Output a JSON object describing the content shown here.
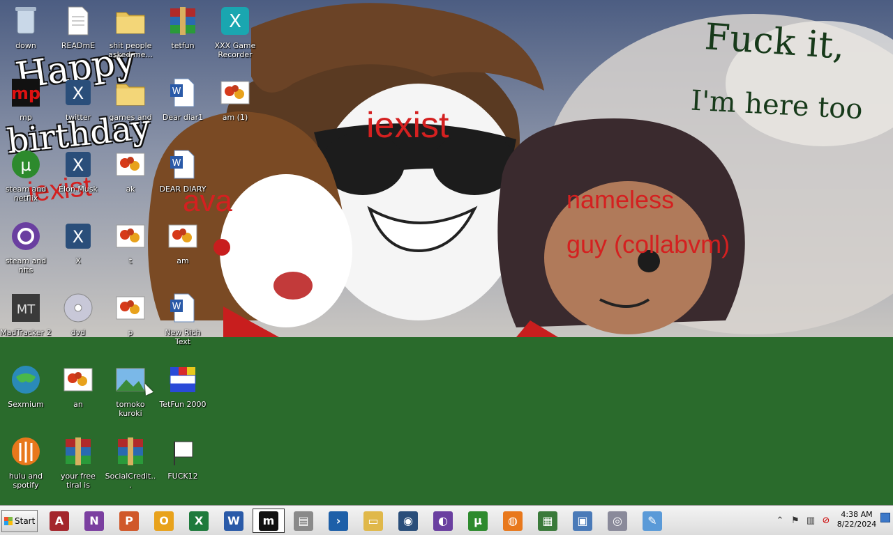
{
  "desktop": {
    "colors": {
      "green": "#2a6b2c",
      "overlay_red": "#d42020"
    },
    "overlays": {
      "happy": "Happy",
      "birthday": "birthday",
      "iexist_corner": "iexist",
      "iexist": "iexist",
      "ava": "ava",
      "nameless": "nameless",
      "guy": "guy (collabvm)",
      "fuck_it": "Fuck it,",
      "here_too": "I'm here too"
    },
    "icons": [
      {
        "label": "down",
        "icon": "recycle-bin-icon"
      },
      {
        "label": "READmE",
        "icon": "text-file-icon"
      },
      {
        "label": "shit people asked me...",
        "icon": "folder-icon"
      },
      {
        "label": "tetfun",
        "icon": "winrar-archive-icon"
      },
      {
        "label": "XXX Game Recorder",
        "icon": "xsplit-icon"
      },
      {
        "label": "mp",
        "icon": "mp-app-icon"
      },
      {
        "label": "twitter",
        "icon": "x-app-icon"
      },
      {
        "label": "games and",
        "icon": "folder-icon"
      },
      {
        "label": "Dear diar1",
        "icon": "word-document-icon"
      },
      {
        "label": "am (1)",
        "icon": "image-file-icon"
      },
      {
        "label": "steam and netflix",
        "icon": "utorrent-icon"
      },
      {
        "label": "Elon Musk",
        "icon": "x-app-icon"
      },
      {
        "label": "ak",
        "icon": "image-file-icon"
      },
      {
        "label": "DEAR DIARY",
        "icon": "word-document-icon"
      },
      {
        "label": "steam and nfts",
        "icon": "bittorrent-icon"
      },
      {
        "label": "X",
        "icon": "x-app-icon"
      },
      {
        "label": "t",
        "icon": "image-file-icon"
      },
      {
        "label": "am",
        "icon": "image-file-icon"
      },
      {
        "label": "MadTracker 2",
        "icon": "madtracker-icon"
      },
      {
        "label": "dvd",
        "icon": "dvd-icon"
      },
      {
        "label": "p",
        "icon": "image-file-icon"
      },
      {
        "label": "New Rich Text Document",
        "icon": "word-document-icon"
      },
      {
        "label": "Sexmium",
        "icon": "browser-globe-icon"
      },
      {
        "label": "an",
        "icon": "image-file-icon"
      },
      {
        "label": "tomoko kuroki smoking weed",
        "icon": "landscape-image-icon"
      },
      {
        "label": "TetFun 2000",
        "icon": "tetfun-game-icon"
      },
      {
        "label": "hulu and spotify",
        "icon": "bitcomet-icon"
      },
      {
        "label": "your free tiral is expired ...",
        "icon": "winrar-archive-icon"
      },
      {
        "label": "SocialCredit...",
        "icon": "winrar-archive-icon"
      },
      {
        "label": "FUCK12",
        "icon": "flag-file-icon"
      }
    ]
  },
  "taskbar": {
    "start_label": "Start",
    "pinned": [
      {
        "name": "access",
        "icon": "access-icon",
        "glyph": "A",
        "color": "#a4262c"
      },
      {
        "name": "onenote",
        "icon": "onenote-icon",
        "glyph": "N",
        "color": "#7b3fa0"
      },
      {
        "name": "powerpoint",
        "icon": "powerpoint-icon",
        "glyph": "P",
        "color": "#d0582a"
      },
      {
        "name": "outlook",
        "icon": "outlook-icon",
        "glyph": "O",
        "color": "#e8a21c"
      },
      {
        "name": "excel",
        "icon": "excel-icon",
        "glyph": "X",
        "color": "#1e7a3c"
      },
      {
        "name": "word",
        "icon": "word-icon",
        "glyph": "W",
        "color": "#2a5aa8"
      },
      {
        "name": "mp",
        "icon": "mp-app-icon",
        "glyph": "m",
        "color": "#111111"
      },
      {
        "name": "computer",
        "icon": "computer-icon",
        "glyph": "▤",
        "color": "#8a8a8a"
      },
      {
        "name": "powershell",
        "icon": "powershell-icon",
        "glyph": "›",
        "color": "#1d5fa8"
      },
      {
        "name": "explorer",
        "icon": "folder-icon",
        "glyph": "▭",
        "color": "#e0b84a"
      },
      {
        "name": "network",
        "icon": "network-globe-icon",
        "glyph": "◉",
        "color": "#2a4e7a"
      },
      {
        "name": "bittorrent",
        "icon": "bittorrent-icon",
        "glyph": "◐",
        "color": "#6a3fa0"
      },
      {
        "name": "utorrent",
        "icon": "utorrent-icon",
        "glyph": "µ",
        "color": "#2d8a2d"
      },
      {
        "name": "bitcomet",
        "icon": "bitcomet-icon",
        "glyph": "◍",
        "color": "#e8781c"
      },
      {
        "name": "monitor",
        "icon": "task-manager-icon",
        "glyph": "▦",
        "color": "#3a7a3a"
      },
      {
        "name": "control-panel",
        "icon": "control-panel-icon",
        "glyph": "▣",
        "color": "#4a7ab8"
      },
      {
        "name": "dvd",
        "icon": "dvd-icon",
        "glyph": "◎",
        "color": "#8a8a9a"
      },
      {
        "name": "paint",
        "icon": "paint-icon",
        "glyph": "✎",
        "color": "#5a9ad8"
      }
    ],
    "tray": {
      "icons": [
        "show-hidden-icons-icon",
        "action-center-flag-icon",
        "network-icon",
        "volume-muted-icon"
      ],
      "time": "4:38 AM",
      "date": "8/22/2024",
      "show_desktop_icon": "show-desktop-icon"
    }
  }
}
